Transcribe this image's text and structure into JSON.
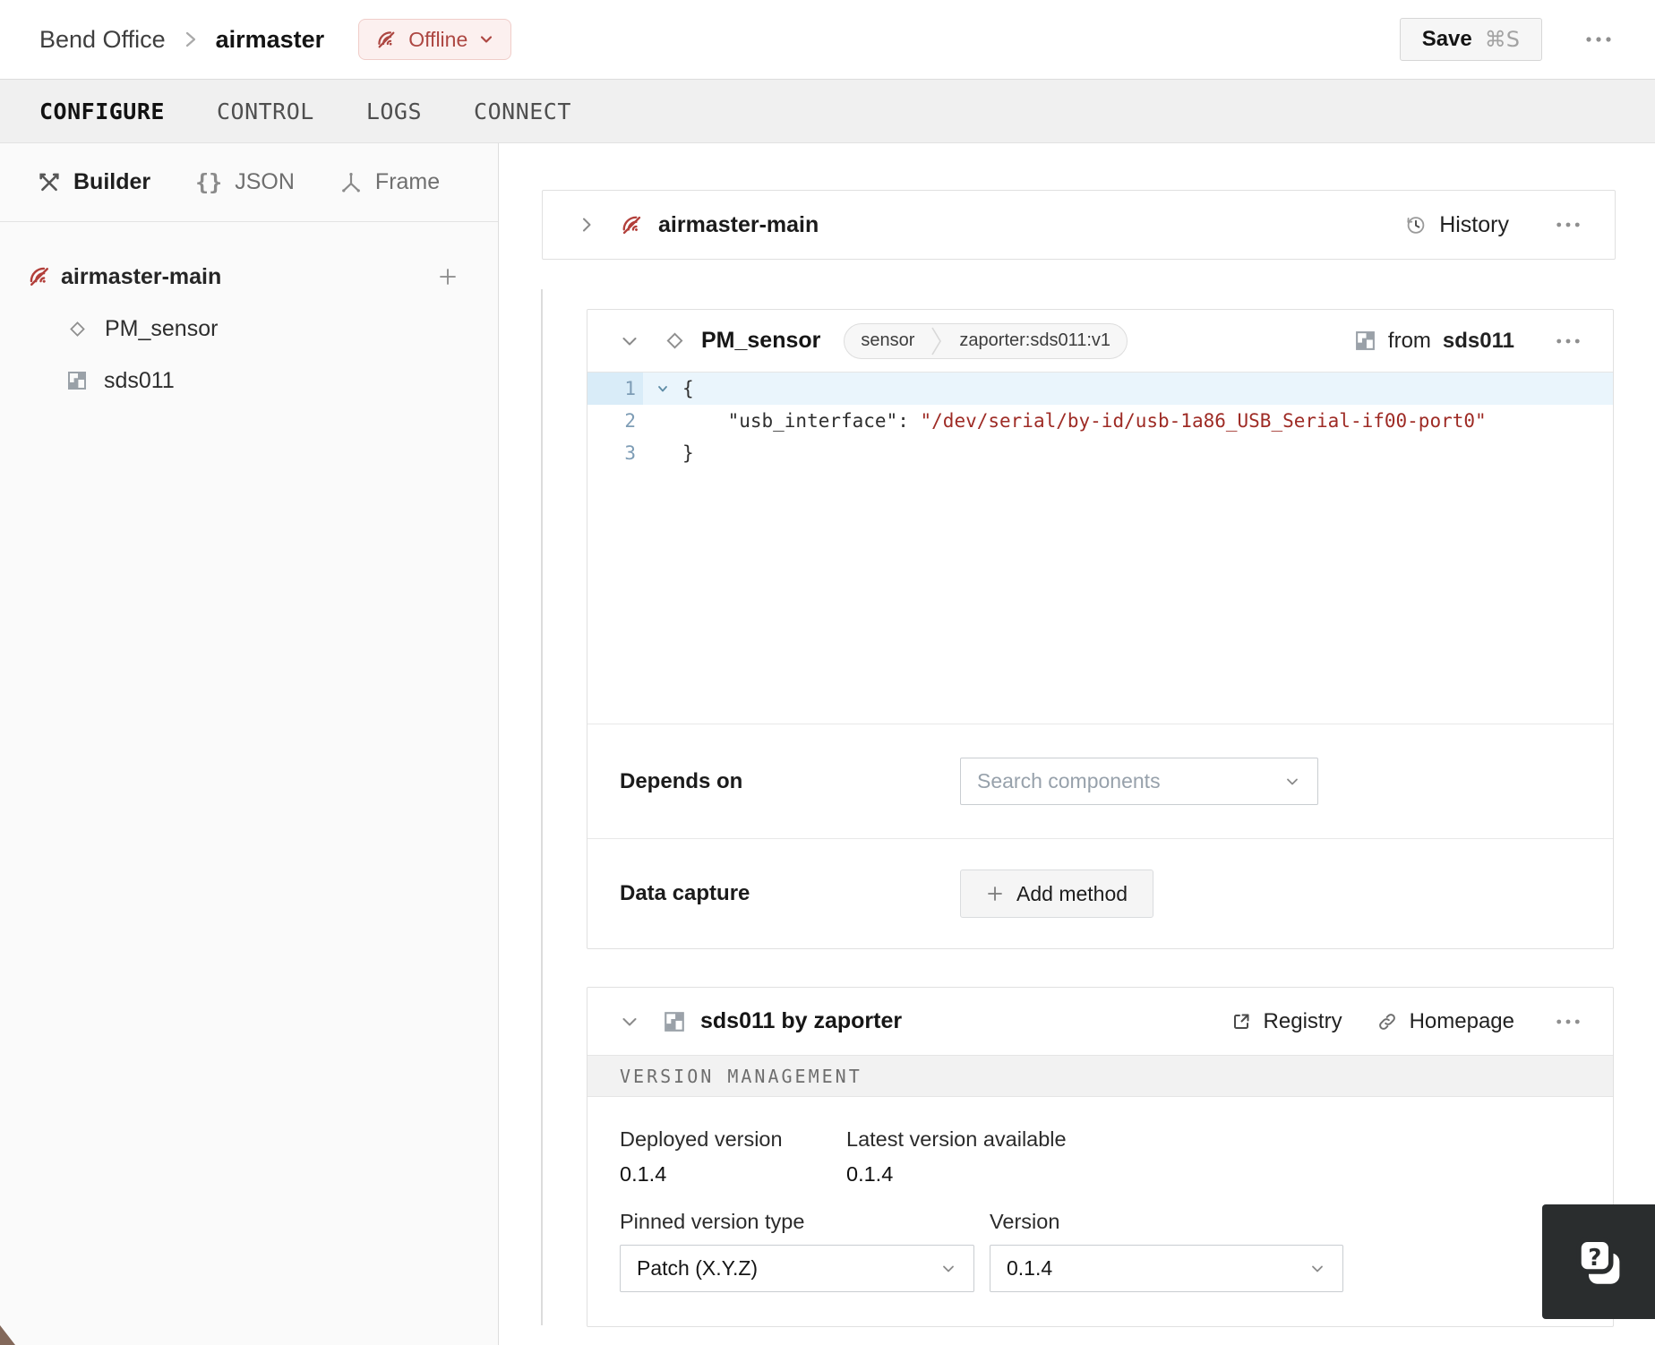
{
  "colors": {
    "accent_red": "#ad4742",
    "offline_badge_bg": "#fcf0ef",
    "code_string": "#9e2b25",
    "active_line_bg": "#eaf5fc",
    "help_button_bg": "#2a2d2e"
  },
  "topbar": {
    "breadcrumb": {
      "parent": "Bend Office",
      "current": "airmaster"
    },
    "status": {
      "label": "Offline",
      "icon": "wifi-off-icon"
    },
    "save": {
      "label": "Save",
      "shortcut": "⌘S"
    }
  },
  "tabs": [
    {
      "label": "CONFIGURE",
      "active": true
    },
    {
      "label": "CONTROL",
      "active": false
    },
    {
      "label": "LOGS",
      "active": false
    },
    {
      "label": "CONNECT",
      "active": false
    }
  ],
  "sidebar": {
    "modes": [
      {
        "label": "Builder",
        "icon": "tools-icon",
        "active": true
      },
      {
        "label": "JSON",
        "icon": "braces-icon",
        "active": false
      },
      {
        "label": "Frame",
        "icon": "frame-axes-icon",
        "active": false
      }
    ],
    "tree": {
      "machine": {
        "label": "airmaster-main",
        "icon": "wifi-off-icon"
      },
      "children": [
        {
          "label": "PM_sensor",
          "icon": "diamond-icon"
        },
        {
          "label": "sds011",
          "icon": "module-icon"
        }
      ]
    }
  },
  "icons": {
    "braces": "{}"
  },
  "machine_card": {
    "title": "airmaster-main",
    "history_label": "History"
  },
  "component_card": {
    "title": "PM_sensor",
    "type_badge": "sensor",
    "model_badge": "zaporter:sds011:v1",
    "from_label": "from",
    "from_module": "sds011",
    "editor": {
      "lines": [
        {
          "n": "1",
          "text": "{"
        },
        {
          "n": "2",
          "key": "\"usb_interface\":",
          "value": "\"/dev/serial/by-id/usb-1a86_USB_Serial-if00-port0\""
        },
        {
          "n": "3",
          "text": "}"
        }
      ]
    },
    "depends_label": "Depends on",
    "depends_placeholder": "Search components",
    "capture_label": "Data capture",
    "add_method_label": "Add method"
  },
  "module_card": {
    "title": "sds011 by zaporter",
    "registry_label": "Registry",
    "homepage_label": "Homepage",
    "section_header": "VERSION MANAGEMENT",
    "deployed_label": "Deployed version",
    "deployed_value": "0.1.4",
    "latest_label": "Latest version available",
    "latest_value": "0.1.4",
    "pinned_label": "Pinned version type",
    "pinned_value": "Patch (X.Y.Z)",
    "version_label": "Version",
    "version_value": "0.1.4"
  }
}
